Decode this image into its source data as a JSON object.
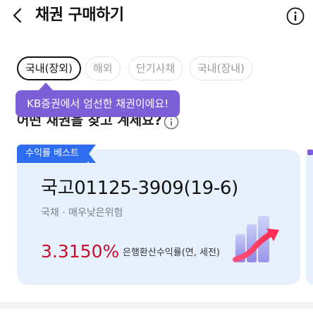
{
  "header": {
    "title": "채권 구매하기",
    "back_icon": "chevron-left-icon",
    "info_icon": "info-icon"
  },
  "filters": [
    {
      "label": "국내(장외)",
      "active": true
    },
    {
      "label": "해외",
      "active": false
    },
    {
      "label": "단기사채",
      "active": false
    },
    {
      "label": "국내(장내)",
      "active": false
    }
  ],
  "subheading": "어떤 채권을 찾고 계세요?",
  "help_icon": "info-icon",
  "tooltip": "KB증권에서 엄선한 채권이에요!",
  "card": {
    "badge": "수익률 베스트",
    "name": "국고01125-3909(19-6)",
    "meta": "국채 · 매우낮은위험",
    "rate": "3.3150%",
    "rate_label": "은행환산수익률(연, 세전)",
    "graphic_icon": "rising-chart-icon"
  },
  "colors": {
    "accent": "#7b5fd6",
    "badge": "#2e6cf0",
    "rate": "#c8102e",
    "card_bg": "#e6f1fd"
  }
}
